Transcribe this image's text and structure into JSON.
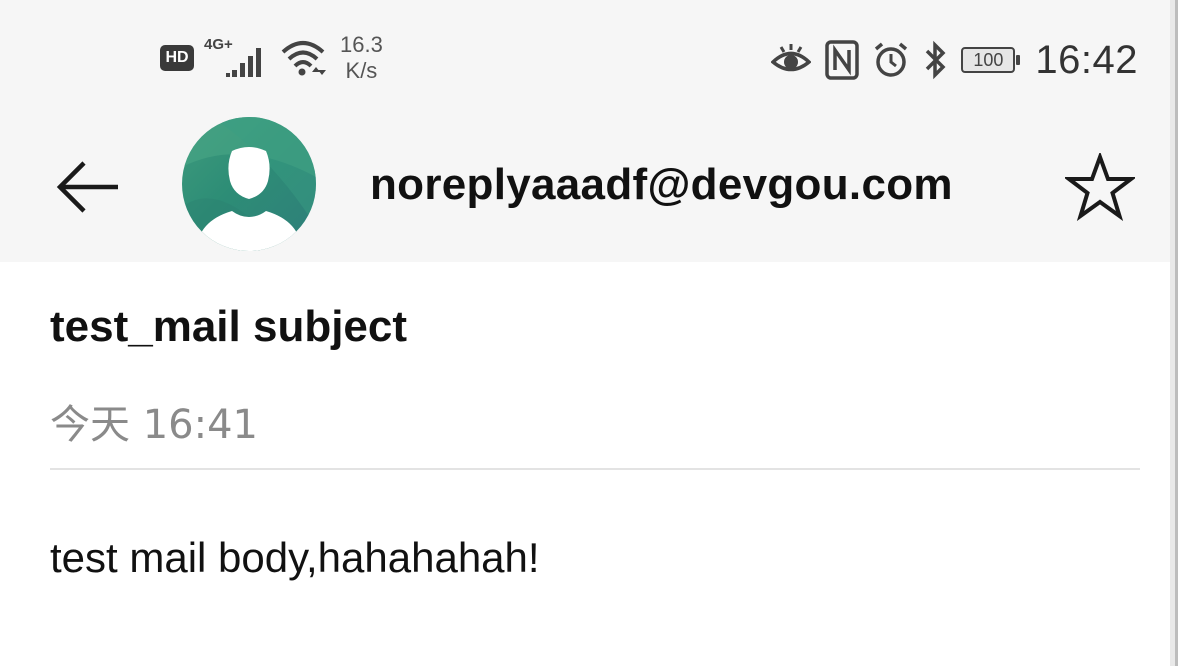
{
  "status_bar": {
    "hd_label": "HD",
    "network_label": "4G+",
    "speed_value": "16.3",
    "speed_unit": "K/s",
    "battery_level": "100",
    "time": "16:42",
    "icons": [
      "hd-icon",
      "signal-icon",
      "wifi-icon",
      "eye-icon",
      "nfc-icon",
      "alarm-icon",
      "bluetooth-icon",
      "battery-icon"
    ]
  },
  "header": {
    "sender_email": "noreplyaaadf@devgou.com",
    "icons": [
      "back-arrow-icon",
      "avatar-icon",
      "star-icon"
    ]
  },
  "message": {
    "subject": "test_mail subject",
    "date": "今天 16:41",
    "body": "test mail body,hahahahah!"
  },
  "colors": {
    "header_bg": "#f6f6f6",
    "avatar_green": "#2d8d76",
    "date_gray": "#8a8a8a",
    "divider": "#e3e3e3"
  }
}
